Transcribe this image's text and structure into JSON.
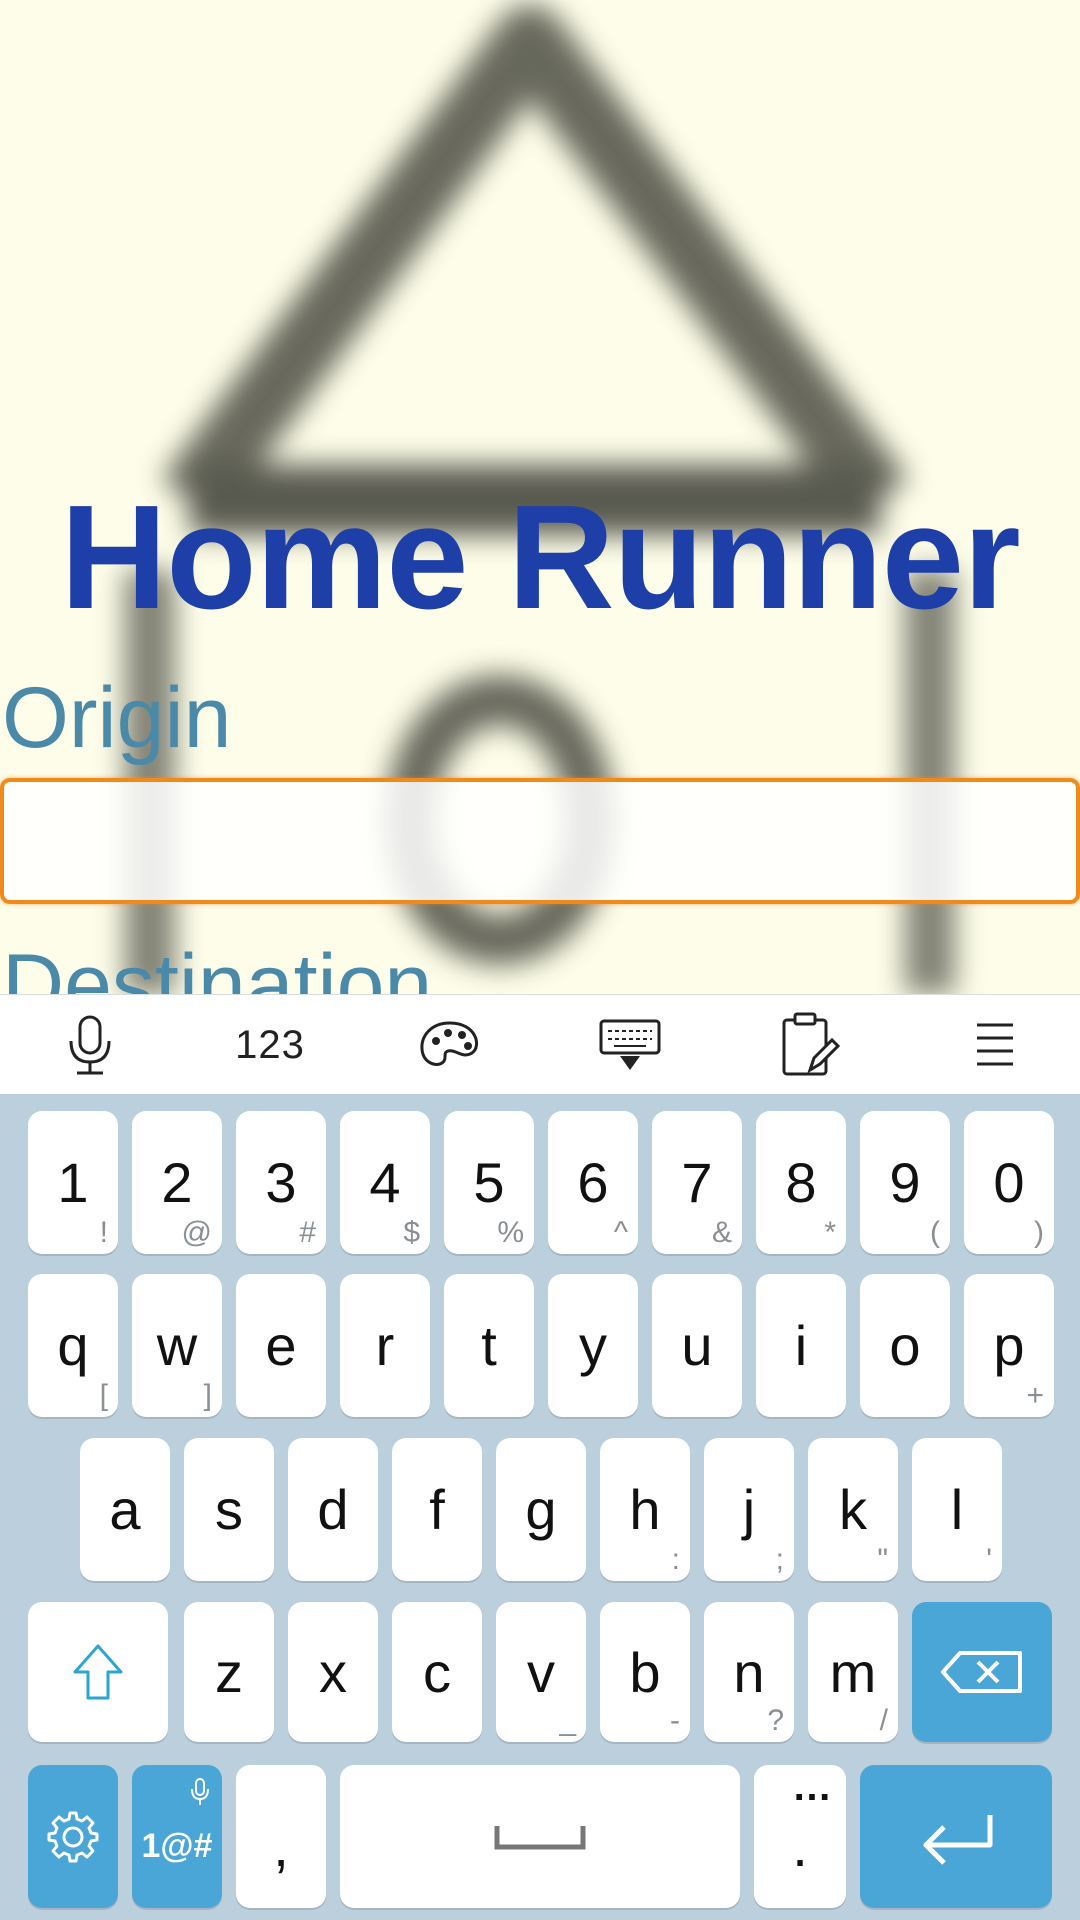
{
  "app": {
    "title": "Home Runner",
    "origin_label": "Origin",
    "origin_value": "",
    "destination_label": "Destination"
  },
  "toolbar": {
    "items": [
      {
        "name": "microphone-icon"
      },
      {
        "name": "numeric-mode",
        "label": "123"
      },
      {
        "name": "palette-icon"
      },
      {
        "name": "hide-keyboard-icon"
      },
      {
        "name": "clipboard-edit-icon"
      },
      {
        "name": "menu-icon"
      }
    ]
  },
  "keyboard": {
    "row_numbers": [
      {
        "main": "1",
        "sub": "!"
      },
      {
        "main": "2",
        "sub": "@"
      },
      {
        "main": "3",
        "sub": "#"
      },
      {
        "main": "4",
        "sub": "$"
      },
      {
        "main": "5",
        "sub": "%"
      },
      {
        "main": "6",
        "sub": "^"
      },
      {
        "main": "7",
        "sub": "&"
      },
      {
        "main": "8",
        "sub": "*"
      },
      {
        "main": "9",
        "sub": "("
      },
      {
        "main": "0",
        "sub": ")"
      }
    ],
    "row_top": [
      {
        "main": "q",
        "sub": "["
      },
      {
        "main": "w",
        "sub": "]"
      },
      {
        "main": "e",
        "sub": ""
      },
      {
        "main": "r",
        "sub": ""
      },
      {
        "main": "t",
        "sub": ""
      },
      {
        "main": "y",
        "sub": ""
      },
      {
        "main": "u",
        "sub": ""
      },
      {
        "main": "i",
        "sub": ""
      },
      {
        "main": "o",
        "sub": ""
      },
      {
        "main": "p",
        "sub": "+"
      }
    ],
    "row_home": [
      {
        "main": "a",
        "sub": ""
      },
      {
        "main": "s",
        "sub": ""
      },
      {
        "main": "d",
        "sub": ""
      },
      {
        "main": "f",
        "sub": ""
      },
      {
        "main": "g",
        "sub": ""
      },
      {
        "main": "h",
        "sub": ":"
      },
      {
        "main": "j",
        "sub": ";"
      },
      {
        "main": "k",
        "sub": "\""
      },
      {
        "main": "l",
        "sub": "'"
      }
    ],
    "row_bottom": [
      {
        "main": "z",
        "sub": ""
      },
      {
        "main": "x",
        "sub": ""
      },
      {
        "main": "c",
        "sub": ""
      },
      {
        "main": "v",
        "sub": "_"
      },
      {
        "main": "b",
        "sub": "-"
      },
      {
        "main": "n",
        "sub": "?"
      },
      {
        "main": "m",
        "sub": "/"
      }
    ],
    "symbols_label": "1@#",
    "comma": ",",
    "period": ".",
    "period_sub": "…"
  },
  "colors": {
    "background": "#fdfde9",
    "title": "#1e3fa8",
    "label": "#4a8aa8",
    "input_border": "#f08a1c",
    "keyboard_bg": "#bccfdc",
    "key_accent": "#4aa6d6"
  }
}
